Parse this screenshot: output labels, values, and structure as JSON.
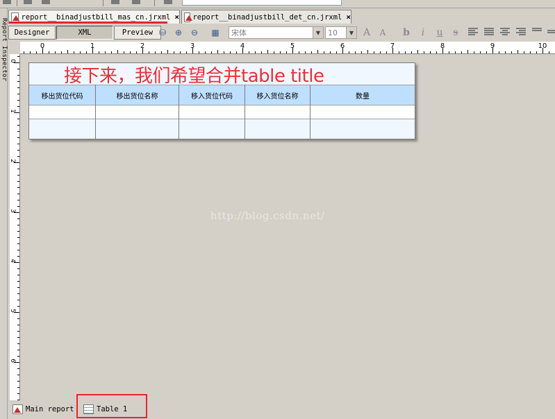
{
  "file_tabs": [
    {
      "label": "report__binadjustbill_mas_cn.jrxml",
      "close": "×",
      "active": true
    },
    {
      "label": "report__binadjustbill_det_cn.jrxml",
      "close": "×",
      "active": false
    }
  ],
  "left_panel": {
    "label": "Report Inspector"
  },
  "view_buttons": {
    "designer": "Designer",
    "xml": "XML",
    "preview": "Preview"
  },
  "toolbar": {
    "font_name": "宋体",
    "font_size": "10"
  },
  "ruler": {
    "h_numbers": [
      "0",
      "1",
      "2",
      "3",
      "4",
      "5",
      "6",
      "7",
      "8",
      "9",
      "10"
    ],
    "v_numbers": [
      "0",
      "1",
      "2",
      "3",
      "4",
      "5",
      "6"
    ]
  },
  "annotation": "接下来，我们希望合并table title",
  "table": {
    "columns": [
      "移出货位代码",
      "移出货位名称",
      "移入货位代码",
      "移入货位名称",
      "数量"
    ]
  },
  "watermark": "http://blog.csdn.net/",
  "bottom_tabs": {
    "main": "Main report",
    "table": "Table 1"
  },
  "colors": {
    "accent_red": "#e8232f",
    "header_blue": "#bfdfff",
    "title_row": "#f0f7ff"
  }
}
